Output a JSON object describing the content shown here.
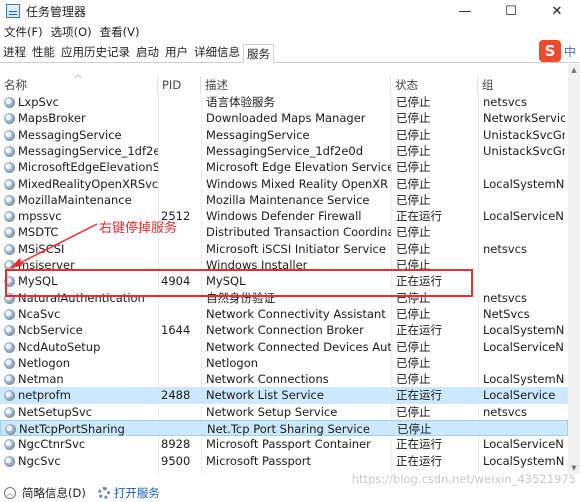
{
  "window": {
    "title": "任务管理器",
    "btn_min": "—",
    "btn_max": "☐",
    "btn_close": "✕"
  },
  "menu": [
    "文件(F)",
    "选项(O)",
    "查看(V)"
  ],
  "tabs": [
    {
      "label": "进程",
      "active": false
    },
    {
      "label": "性能",
      "active": false
    },
    {
      "label": "应用历史记录",
      "active": false
    },
    {
      "label": "启动",
      "active": false
    },
    {
      "label": "用户",
      "active": false
    },
    {
      "label": "详细信息",
      "active": false
    },
    {
      "label": "服务",
      "active": true
    }
  ],
  "ime": {
    "logo": "S",
    "lang": "中"
  },
  "columns": {
    "name": "名称",
    "pid": "PID",
    "desc": "描述",
    "status": "状态",
    "group": "组"
  },
  "rows": [
    {
      "name": "LxpSvc",
      "pid": "",
      "desc": "语言体验服务",
      "status": "已停止",
      "group": "netsvcs",
      "style": ""
    },
    {
      "name": "MapsBroker",
      "pid": "",
      "desc": "Downloaded Maps Manager",
      "status": "已停止",
      "group": "NetworkService",
      "style": ""
    },
    {
      "name": "MessagingService",
      "pid": "",
      "desc": "MessagingService",
      "status": "已停止",
      "group": "UnistackSvcGr...",
      "style": ""
    },
    {
      "name": "MessagingService_1df2e0d",
      "pid": "",
      "desc": "MessagingService_1df2e0d",
      "status": "已停止",
      "group": "UnistackSvcGr...",
      "style": ""
    },
    {
      "name": "MicrosoftEdgeElevationSe...",
      "pid": "",
      "desc": "Microsoft Edge Elevation Service (...",
      "status": "已停止",
      "group": "",
      "style": ""
    },
    {
      "name": "MixedRealityOpenXRSvc",
      "pid": "",
      "desc": "Windows Mixed Reality OpenXR S...",
      "status": "已停止",
      "group": "LocalSystemN...",
      "style": ""
    },
    {
      "name": "MozillaMaintenance",
      "pid": "",
      "desc": "Mozilla Maintenance Service",
      "status": "已停止",
      "group": "",
      "style": ""
    },
    {
      "name": "mpssvc",
      "pid": "2512",
      "desc": "Windows Defender Firewall",
      "status": "正在运行",
      "group": "LocalServiceN...",
      "style": ""
    },
    {
      "name": "MSDTC",
      "pid": "",
      "desc": "Distributed Transaction Coordinator",
      "status": "已停止",
      "group": "",
      "style": ""
    },
    {
      "name": "MSiSCSI",
      "pid": "",
      "desc": "Microsoft iSCSI Initiator Service",
      "status": "已停止",
      "group": "netsvcs",
      "style": ""
    },
    {
      "name": "msiserver",
      "pid": "",
      "desc": "Windows Installer",
      "status": "已停止",
      "group": "",
      "style": ""
    },
    {
      "name": "MySQL",
      "pid": "4904",
      "desc": "MySQL",
      "status": "正在运行",
      "group": "",
      "style": ""
    },
    {
      "name": "NaturalAuthentication",
      "pid": "",
      "desc": "自然身份验证",
      "status": "已停止",
      "group": "netsvcs",
      "style": ""
    },
    {
      "name": "NcaSvc",
      "pid": "",
      "desc": "Network Connectivity Assistant",
      "status": "已停止",
      "group": "NetSvcs",
      "style": ""
    },
    {
      "name": "NcbService",
      "pid": "1644",
      "desc": "Network Connection Broker",
      "status": "正在运行",
      "group": "LocalSystemN...",
      "style": ""
    },
    {
      "name": "NcdAutoSetup",
      "pid": "",
      "desc": "Network Connected Devices Auto-...",
      "status": "已停止",
      "group": "LocalServiceN...",
      "style": ""
    },
    {
      "name": "Netlogon",
      "pid": "",
      "desc": "Netlogon",
      "status": "已停止",
      "group": "",
      "style": ""
    },
    {
      "name": "Netman",
      "pid": "",
      "desc": "Network Connections",
      "status": "已停止",
      "group": "LocalSystemN...",
      "style": ""
    },
    {
      "name": "netprofm",
      "pid": "2488",
      "desc": "Network List Service",
      "status": "正在运行",
      "group": "LocalService",
      "style": "hl"
    },
    {
      "name": "NetSetupSvc",
      "pid": "",
      "desc": "Network Setup Service",
      "status": "已停止",
      "group": "netsvcs",
      "style": ""
    },
    {
      "name": "NetTcpPortSharing",
      "pid": "",
      "desc": "Net.Tcp Port Sharing Service",
      "status": "已停止",
      "group": "",
      "style": "sel"
    },
    {
      "name": "NgcCtnrSvc",
      "pid": "8928",
      "desc": "Microsoft Passport Container",
      "status": "正在运行",
      "group": "LocalServiceN...",
      "style": ""
    },
    {
      "name": "NgcSvc",
      "pid": "9500",
      "desc": "Microsoft Passport",
      "status": "正在运行",
      "group": "LocalSystemN...",
      "style": ""
    }
  ],
  "annotation": {
    "text": "右键停掉服务",
    "color": "#e62e2e"
  },
  "statusbar": {
    "brief": "简略信息(D)",
    "open_services": "打开服务"
  },
  "watermark": "https://blog.csdn.net/weixin_43521975",
  "colors": {
    "selected_row": "#cce8ff",
    "annotation": "#e62e2e",
    "link": "#1a5fb4"
  }
}
